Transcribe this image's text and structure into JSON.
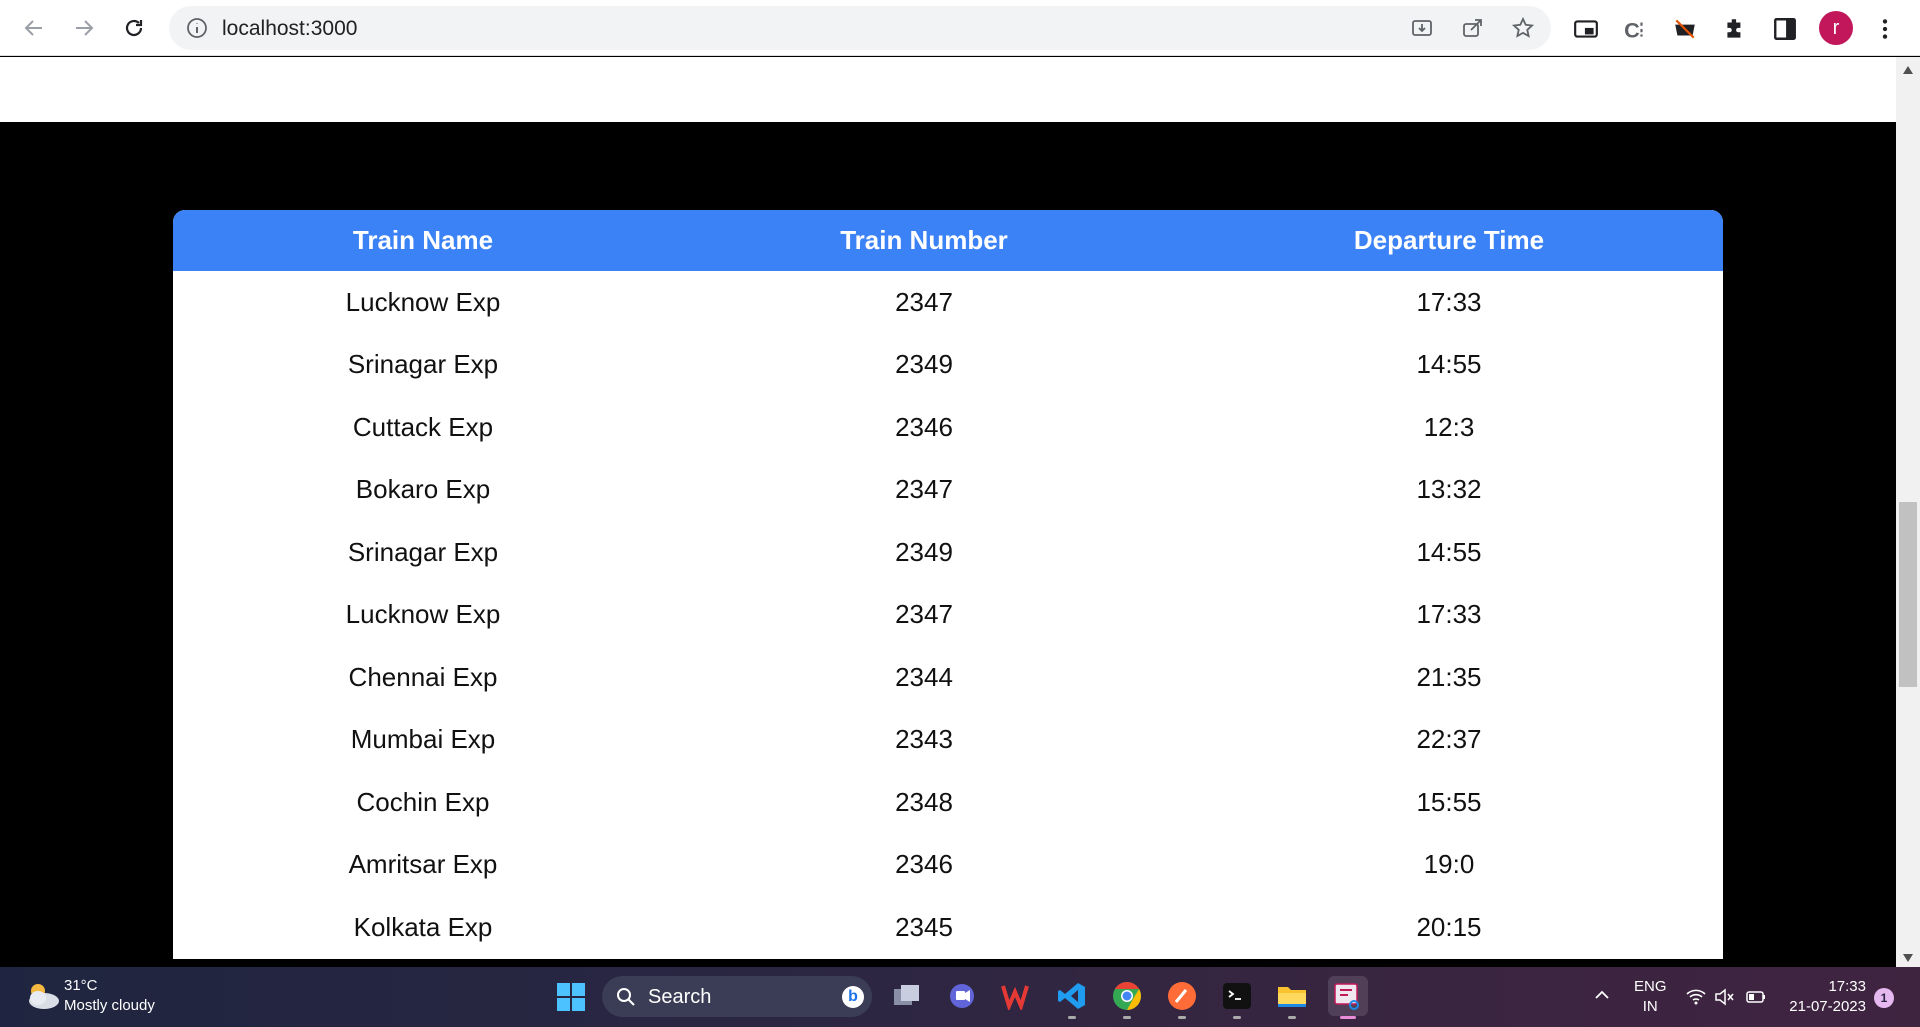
{
  "browser": {
    "url": "localhost:3000",
    "avatar_initial": "r"
  },
  "table": {
    "headers": [
      "Train Name",
      "Train Number",
      "Departure Time"
    ],
    "rows": [
      [
        "Lucknow Exp",
        "2347",
        "17:33"
      ],
      [
        "Srinagar Exp",
        "2349",
        "14:55"
      ],
      [
        "Cuttack Exp",
        "2346",
        "12:3"
      ],
      [
        "Bokaro Exp",
        "2347",
        "13:32"
      ],
      [
        "Srinagar Exp",
        "2349",
        "14:55"
      ],
      [
        "Lucknow Exp",
        "2347",
        "17:33"
      ],
      [
        "Chennai Exp",
        "2344",
        "21:35"
      ],
      [
        "Mumbai Exp",
        "2343",
        "22:37"
      ],
      [
        "Cochin Exp",
        "2348",
        "15:55"
      ],
      [
        "Amritsar Exp",
        "2346",
        "19:0"
      ],
      [
        "Kolkata Exp",
        "2345",
        "20:15"
      ]
    ],
    "header_color": "#3b82f6"
  },
  "taskbar": {
    "weather_temp": "31°C",
    "weather_condition": "Mostly cloudy",
    "search_label": "Search",
    "lang_line1": "ENG",
    "lang_line2": "IN",
    "time": "17:33",
    "date": "21-07-2023",
    "notification_count": "1"
  }
}
